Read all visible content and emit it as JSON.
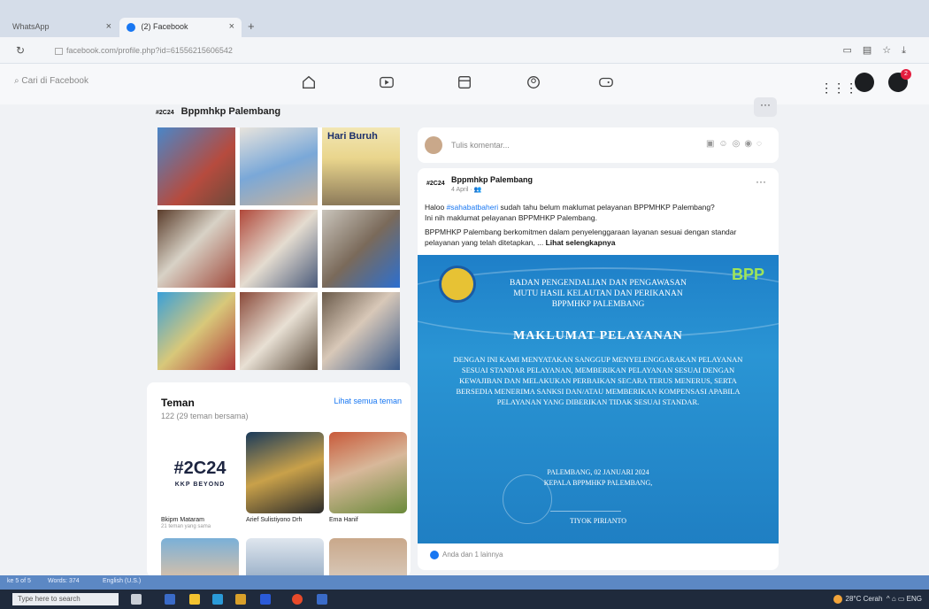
{
  "browser": {
    "tabs": [
      {
        "label": "WhatsApp"
      },
      {
        "label": "(2) Facebook"
      }
    ],
    "new_tab": "+",
    "url": "facebook.com/profile.php?id=61556215606542"
  },
  "fb": {
    "search_placeholder": "Cari di Facebook",
    "notification_count": "2"
  },
  "page": {
    "name": "Bppmhkp Palembang",
    "logo_text": "#2C24",
    "more": "···"
  },
  "photos": {
    "caption": "Hari Buruh"
  },
  "friends": {
    "title": "Teman",
    "see_all": "Lihat semua teman",
    "count": "122 (29 teman bersama)",
    "items": [
      {
        "name": "Bkipm Mataram",
        "sub": "21 teman yang sama",
        "graphic_line1": "#2C24",
        "graphic_line2": "KKP BEYOND"
      },
      {
        "name": "Arief Sulistiyono Drh",
        "sub": ""
      },
      {
        "name": "Ema Hanif",
        "sub": ""
      }
    ]
  },
  "comment": {
    "placeholder": "Tulis komentar..."
  },
  "post": {
    "author": "Bppmhkp Palembang",
    "date": "4 April",
    "line1_pre": "Haloo ",
    "line1_tag": "#sahabatbaheri",
    "line1_post": " sudah tahu belum maklumat pelayanan BPPMHKP Palembang?",
    "line2": "Ini nih maklumat pelayanan BPPMHKP Palembang.",
    "line3": "BPPMHKP Palembang berkomitmen dalam penyelenggaraan layanan sesuai dengan standar",
    "line4_pre": "pelayanan yang telah ditetapkan, ... ",
    "line4_more": "Lihat selengkapnya",
    "reactions": "Anda dan 1 lainnya"
  },
  "banner": {
    "org_line1": "BADAN PENGENDALIAN DAN PENGAWASAN",
    "org_line2": "MUTU HASIL KELAUTAN DAN PERIKANAN",
    "org_line3": "BPPMHKP PALEMBANG",
    "bpp_logo": "BPP",
    "title": "MAKLUMAT PELAYANAN",
    "body": "Dengan ini kami menyatakan sanggup menyelenggarakan pelayanan sesuai standar pelayanan, memberikan pelayanan sesuai dengan kewajiban dan melakukan perbaikan secara terus menerus, serta bersedia menerima sanksi dan/atau memberikan kompensasi apabila pelayanan yang diberikan tidak sesuai standar.",
    "place_date": "PALEMBANG, 02 JANUARI 2024",
    "position": "KEPALA BPPMHKP PALEMBANG,",
    "signer": "TIYOK PIRIANTO"
  },
  "taskbar": {
    "status_left": "ke 5 of 5",
    "status_words": "Words: 374",
    "status_lang": "English (U.S.)",
    "search_placeholder": "Type here to search",
    "weather": "28°C Cerah",
    "lang": "ENG"
  },
  "colors": {
    "fb_blue": "#1877f2",
    "banner_blue": "#2a95d4",
    "badge_red": "#e41e3f",
    "taskbar": "#1f2a3c"
  }
}
